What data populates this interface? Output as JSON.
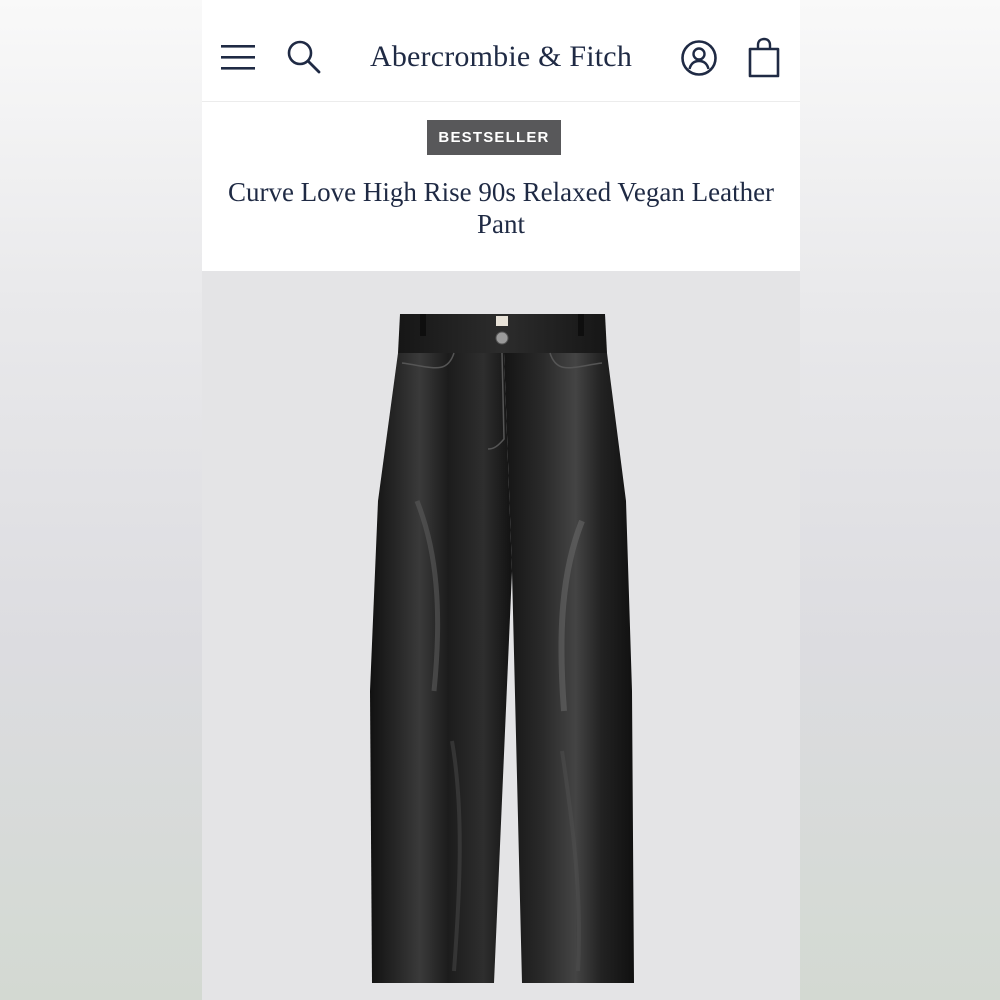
{
  "header": {
    "logo_text": "Abercrombie & Fitch",
    "icons": {
      "menu": "hamburger-menu-icon",
      "search": "search-icon",
      "account": "account-icon",
      "bag": "shopping-bag-icon"
    }
  },
  "product": {
    "badge": "BESTSELLER",
    "title": "Curve Love High Rise 90s Relaxed Vegan Leather Pant",
    "image": "black vegan leather pants"
  },
  "colors": {
    "brand_navy": "#1f2a44",
    "badge_bg": "#58585a",
    "image_bg": "#e4e4e6"
  }
}
